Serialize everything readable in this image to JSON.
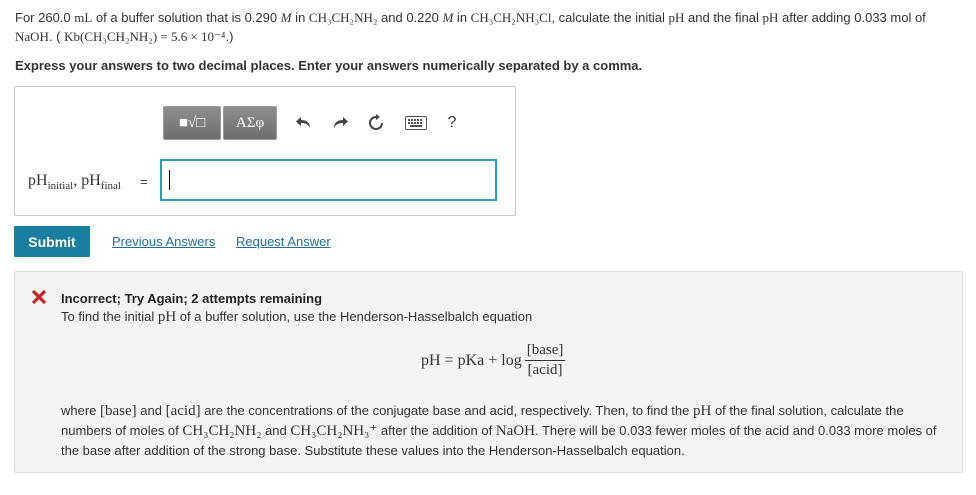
{
  "question": {
    "p1": "For 260.0 ",
    "mL": "mL",
    "p2": " of a buffer solution that is 0.290 ",
    "M1": "M",
    "p3": " in ",
    "base_formula": "CH₃CH₂NH₂",
    "p4": " and 0.220 ",
    "M2": "M",
    "p5": " in ",
    "acid_formula": "CH₃CH₂NH₃Cl",
    "p6": ", calculate the initial ",
    "pH1": "pH",
    "p7": " and the final ",
    "pH2": "pH",
    "p8": " after adding 0.033 mol of ",
    "naoh": "NaOH",
    "p9": ". ( ",
    "kb_expr": "Kb(CH₃CH₂NH₂) = 5.6 × 10⁻⁴",
    "p10": ".)"
  },
  "instructions": "Express your answers to two decimal places. Enter your answers numerically separated by a comma.",
  "toolbar": {
    "templates_label": "■√□",
    "greek_label": "ΑΣφ",
    "help_label": "?"
  },
  "input": {
    "label_main1": "pH",
    "label_sub1": "initial",
    "label_sep": ", ",
    "label_main2": "pH",
    "label_sub2": "final",
    "equals": "=",
    "value": ""
  },
  "actions": {
    "submit": "Submit",
    "previous_answers": "Previous Answers",
    "request_answer": "Request Answer"
  },
  "feedback": {
    "title": "Incorrect; Try Again; 2 attempts remaining",
    "line1_a": "To find the initial ",
    "line1_pH": "pH",
    "line1_b": " of a buffer solution, use the Henderson-Hasselbalch equation",
    "formula_lhs": "pH = pKa + log",
    "formula_num": "[base]",
    "formula_den": "[acid]",
    "para": {
      "a": "where ",
      "base": "[base]",
      "b": " and ",
      "acid": "[acid]",
      "c": " are the concentrations of the conjugate base and acid, respectively. Then, to find the ",
      "pH": "pH",
      "d": " of the final solution, calculate the numbers of moles of ",
      "f1": "CH₃CH₂NH₂",
      "e": " and ",
      "f2": "CH₃CH₂NH₃⁺",
      "f": " after the addition of ",
      "naoh": "NaOH",
      "g": ". There will be 0.033 fewer moles of the acid and 0.033 more moles of the base after addition of the strong base.  Substitute these values into the Henderson-Hasselbalch equation."
    }
  },
  "colors": {
    "accent": "#1a7ea0",
    "link": "#1f6fa0",
    "error": "#cc2222",
    "input_border": "#2a9dbd"
  }
}
